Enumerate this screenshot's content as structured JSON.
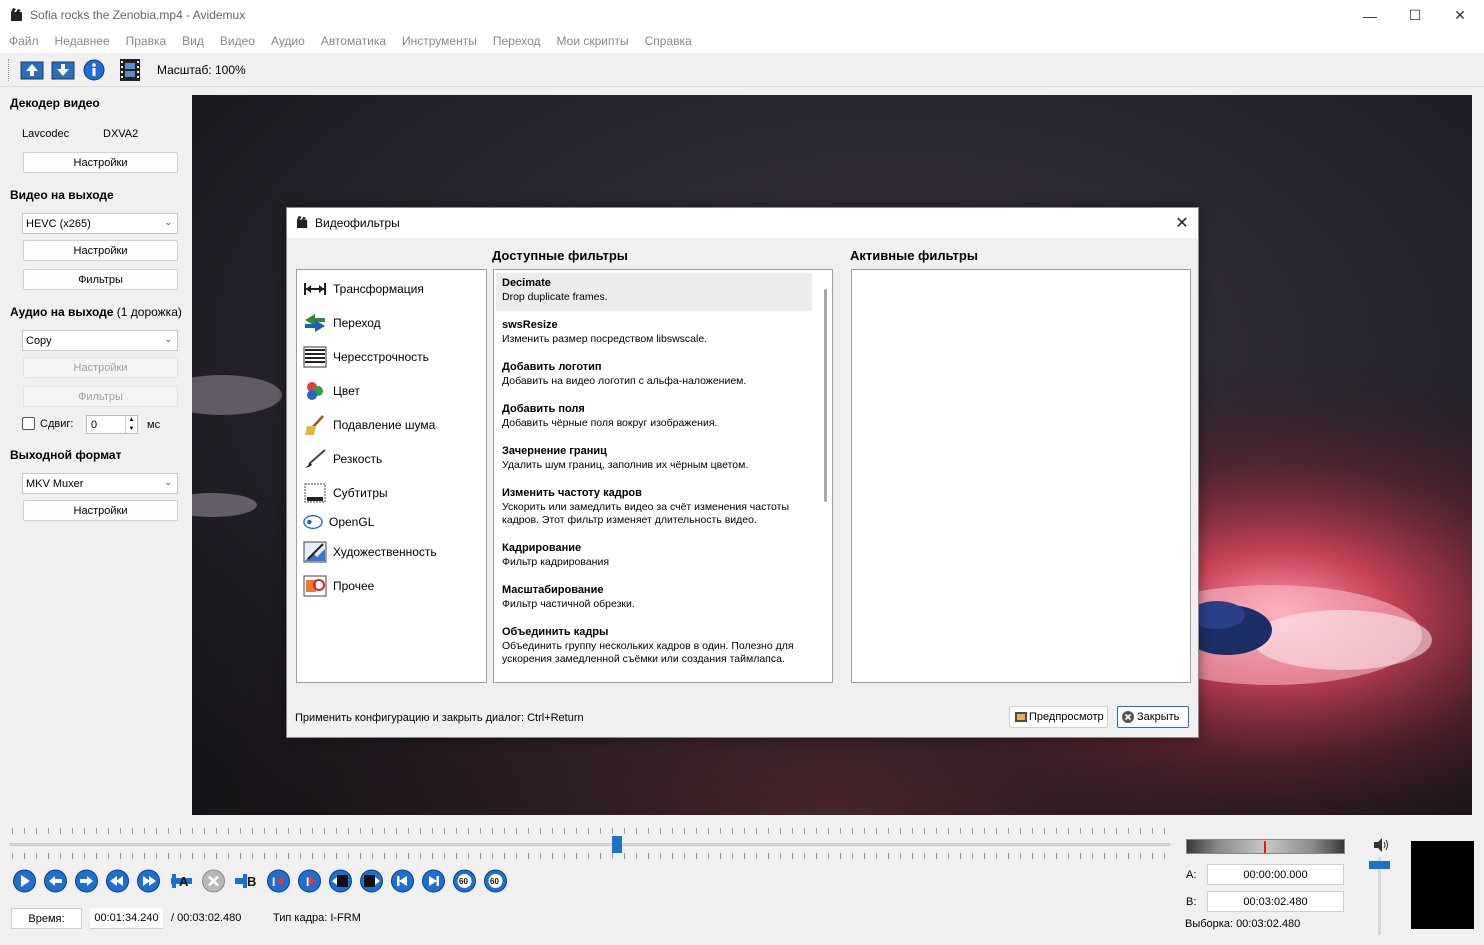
{
  "window": {
    "title": "Sofia rocks the Zenobia.mp4 - Avidemux"
  },
  "menu": [
    "Файл",
    "Недавнее",
    "Правка",
    "Вид",
    "Видео",
    "Аудио",
    "Автоматика",
    "Инструменты",
    "Переход",
    "Мои скрипты",
    "Справка"
  ],
  "toolbar": {
    "zoom": "Масштаб: 100%"
  },
  "left": {
    "decoder_title": "Декодер видео",
    "decoder_name": "Lavcodec",
    "decoder_hw": "DXVA2",
    "decoder_settings": "Настройки",
    "video_out_title": "Видео на выходе",
    "video_codec": "HEVC (x265)",
    "video_settings": "Настройки",
    "video_filters": "Фильтры",
    "audio_out_title": "Аудио на выходе",
    "audio_tracks": "(1 дорожка)",
    "audio_codec": "Copy",
    "audio_settings": "Настройки",
    "audio_filters": "Фильтры",
    "shift_label": "Сдвиг:",
    "shift_value": "0",
    "shift_unit": "мс",
    "format_title": "Выходной формат",
    "format": "MKV Muxer",
    "format_settings": "Настройки"
  },
  "dialog": {
    "title": "Видеофильтры",
    "available_title": "Доступные фильтры",
    "active_title": "Активные фильтры",
    "categories": [
      {
        "label": "Трансформация",
        "icon": "transform-icon"
      },
      {
        "label": "Переход",
        "icon": "transition-icon"
      },
      {
        "label": "Чересстрочность",
        "icon": "interlace-icon"
      },
      {
        "label": "Цвет",
        "icon": "color-icon"
      },
      {
        "label": "Подавление шума",
        "icon": "denoise-icon"
      },
      {
        "label": "Резкость",
        "icon": "sharpness-icon"
      },
      {
        "label": "Субтитры",
        "icon": "subtitles-icon"
      },
      {
        "label": "OpenGL",
        "icon": "opengl-icon"
      },
      {
        "label": "Художественность",
        "icon": "artistic-icon"
      },
      {
        "label": "Прочее",
        "icon": "misc-icon"
      }
    ],
    "filters": [
      {
        "name": "Decimate",
        "desc": "Drop duplicate frames."
      },
      {
        "name": "swsResize",
        "desc": "Изменить размер посредством libswscale."
      },
      {
        "name": "Добавить логотип",
        "desc": "Добавить на видео логотип с альфа-наложением."
      },
      {
        "name": "Добавить поля",
        "desc": "Добавить чёрные поля вокруг изображения."
      },
      {
        "name": "Зачернение границ",
        "desc": "Удалить шум границ, заполнив их чёрным цветом."
      },
      {
        "name": "Изменить частоту кадров",
        "desc": "Ускорить или замедлить видео за счёт изменения частоты кадров. Этот фильтр изменяет длительность видео."
      },
      {
        "name": "Кадрирование",
        "desc": "Фильтр кадрирования"
      },
      {
        "name": "Масштабирование",
        "desc": "Фильтр частичной обрезки."
      },
      {
        "name": "Объединить кадры",
        "desc": "Объединить группу нескольких кадров в один. Полезно для ускорения замедленной съёмки или создания таймлапса."
      }
    ],
    "hint": "Применить конфигурацию и закрыть диалог: Ctrl+Return",
    "preview_btn": "Предпросмотр",
    "close_btn": "Закрыть"
  },
  "bottom": {
    "time_label": "Время:",
    "current_time": "00:01:34.240",
    "total_time": "/ 00:03:02.480",
    "frame_type": "Тип кадра:  I-FRM",
    "a_label": "A:",
    "a_value": "00:00:00.000",
    "b_label": "B:",
    "b_value": "00:03:02.480",
    "selection": "Выборка: 00:03:02.480",
    "position_fraction": 0.523,
    "volume_fraction": 0.9
  },
  "colors": {
    "accent": "#1b73c9",
    "control_blue": "#1e6fcf"
  }
}
